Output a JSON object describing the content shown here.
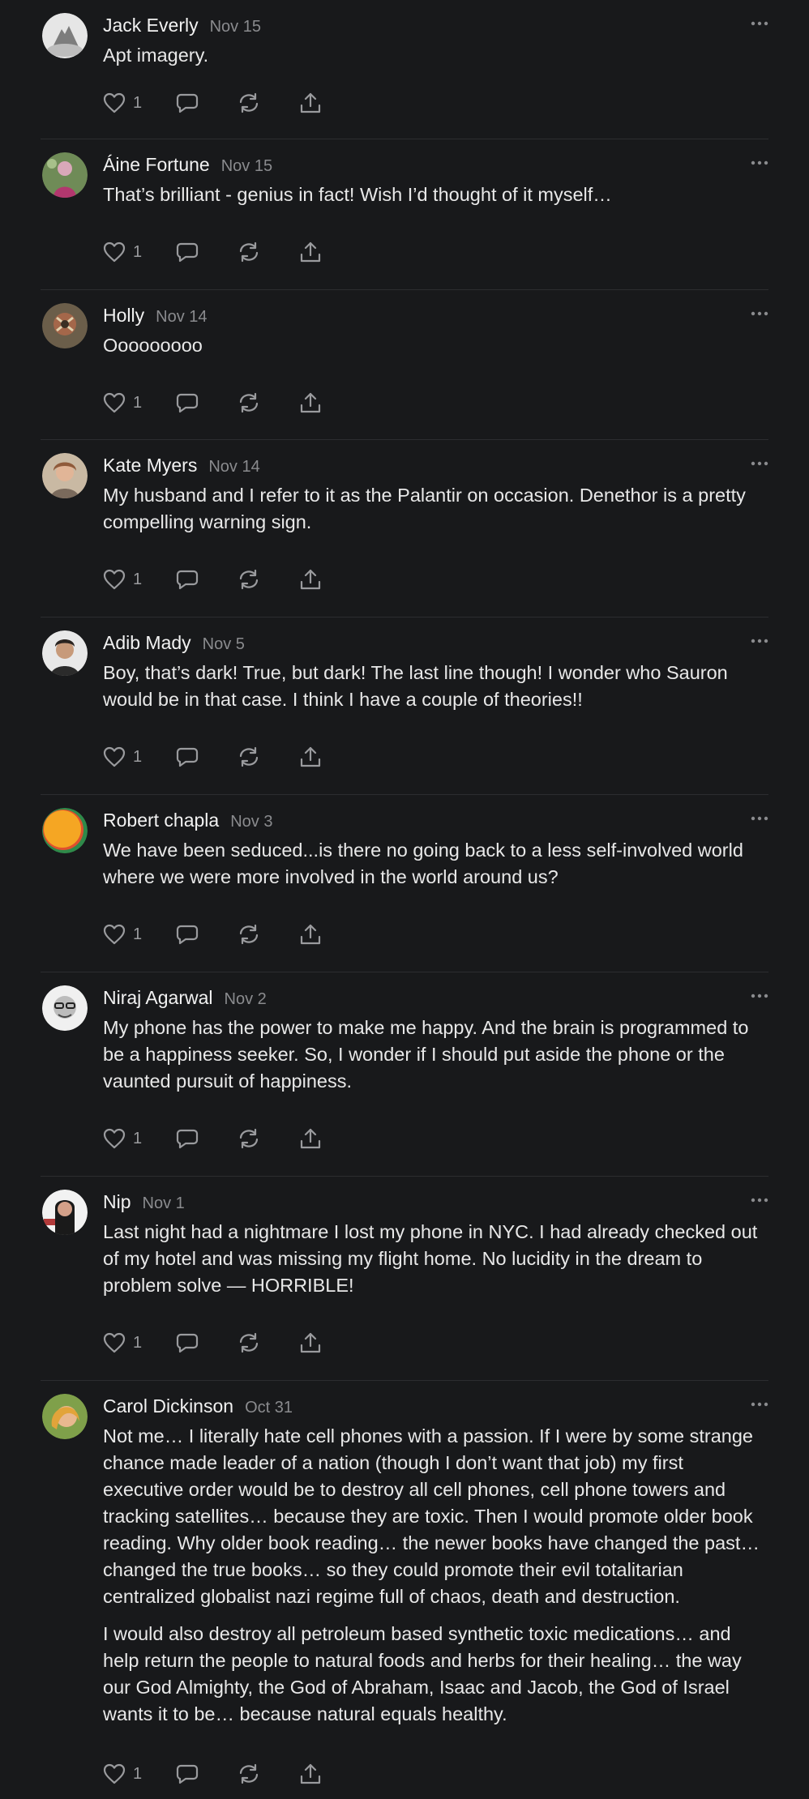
{
  "colors": {
    "background": "#18191b",
    "divider": "#2c2d30",
    "text": "#e8e8e8",
    "muted": "#8a8b8e"
  },
  "icons": {
    "like": "heart-icon",
    "reply": "comment-bubble-icon",
    "restack": "restack-icon",
    "share": "share-icon",
    "more": "more-horizontal-icon"
  },
  "comments": [
    {
      "name": "Jack Everly",
      "date": "Nov 15",
      "paragraphs": [
        "Apt imagery."
      ],
      "likes": "1",
      "avatar": "avatar-jack-everly"
    },
    {
      "name": "Áine Fortune",
      "date": "Nov 15",
      "paragraphs": [
        "That’s brilliant - genius in fact! Wish I’d thought of it myself…"
      ],
      "likes": "1",
      "avatar": "avatar-aine-fortune"
    },
    {
      "name": "Holly",
      "date": "Nov 14",
      "paragraphs": [
        "Ooooooooo"
      ],
      "likes": "1",
      "avatar": "avatar-holly"
    },
    {
      "name": "Kate Myers",
      "date": "Nov 14",
      "paragraphs": [
        "My husband and I refer to it as the Palantir on occasion. Denethor is a pretty compelling warning sign."
      ],
      "likes": "1",
      "avatar": "avatar-kate-myers"
    },
    {
      "name": "Adib Mady",
      "date": "Nov 5",
      "paragraphs": [
        "Boy, that’s dark! True, but dark! The last line though! I wonder who Sauron would be in that case. I think I have a couple of theories!!"
      ],
      "likes": "1",
      "avatar": "avatar-adib-mady"
    },
    {
      "name": "Robert chapla",
      "date": "Nov 3",
      "paragraphs": [
        "We have been seduced...is there no going back to a less self-involved world where we were more involved in the world around us?"
      ],
      "likes": "1",
      "avatar": "avatar-robert-chapla"
    },
    {
      "name": "Niraj Agarwal",
      "date": "Nov 2",
      "paragraphs": [
        "My phone has the power to make me happy. And the brain is programmed to be a happiness seeker. So, I wonder if I should put aside the phone or the vaunted pursuit of happiness."
      ],
      "likes": "1",
      "avatar": "avatar-niraj-agarwal"
    },
    {
      "name": "Nip",
      "date": "Nov 1",
      "paragraphs": [
        "Last night had a nightmare I lost my phone in NYC. I had already checked out of my hotel and was missing my flight home. No lucidity in the dream to problem solve — HORRIBLE!"
      ],
      "likes": "1",
      "avatar": "avatar-nip"
    },
    {
      "name": "Carol Dickinson",
      "date": "Oct 31",
      "paragraphs": [
        "Not me… I literally hate cell phones with a passion. If I were by some strange chance made leader of a nation (though I don’t want that job) my first executive order would be to destroy all cell phones, cell phone towers and tracking satellites… because they are toxic. Then I would promote older book reading. Why older book reading… the newer books have changed the past… changed the true books… so they could promote their evil totalitarian centralized globalist nazi regime full of chaos, death and destruction.",
        "I would also destroy all petroleum based synthetic toxic medications… and help return the people to natural foods and herbs for their healing… the way our God Almighty, the God of Abraham, Isaac and Jacob, the God of Israel wants it to be… because natural equals healthy."
      ],
      "likes": "1",
      "avatar": "avatar-carol-dickinson"
    }
  ]
}
